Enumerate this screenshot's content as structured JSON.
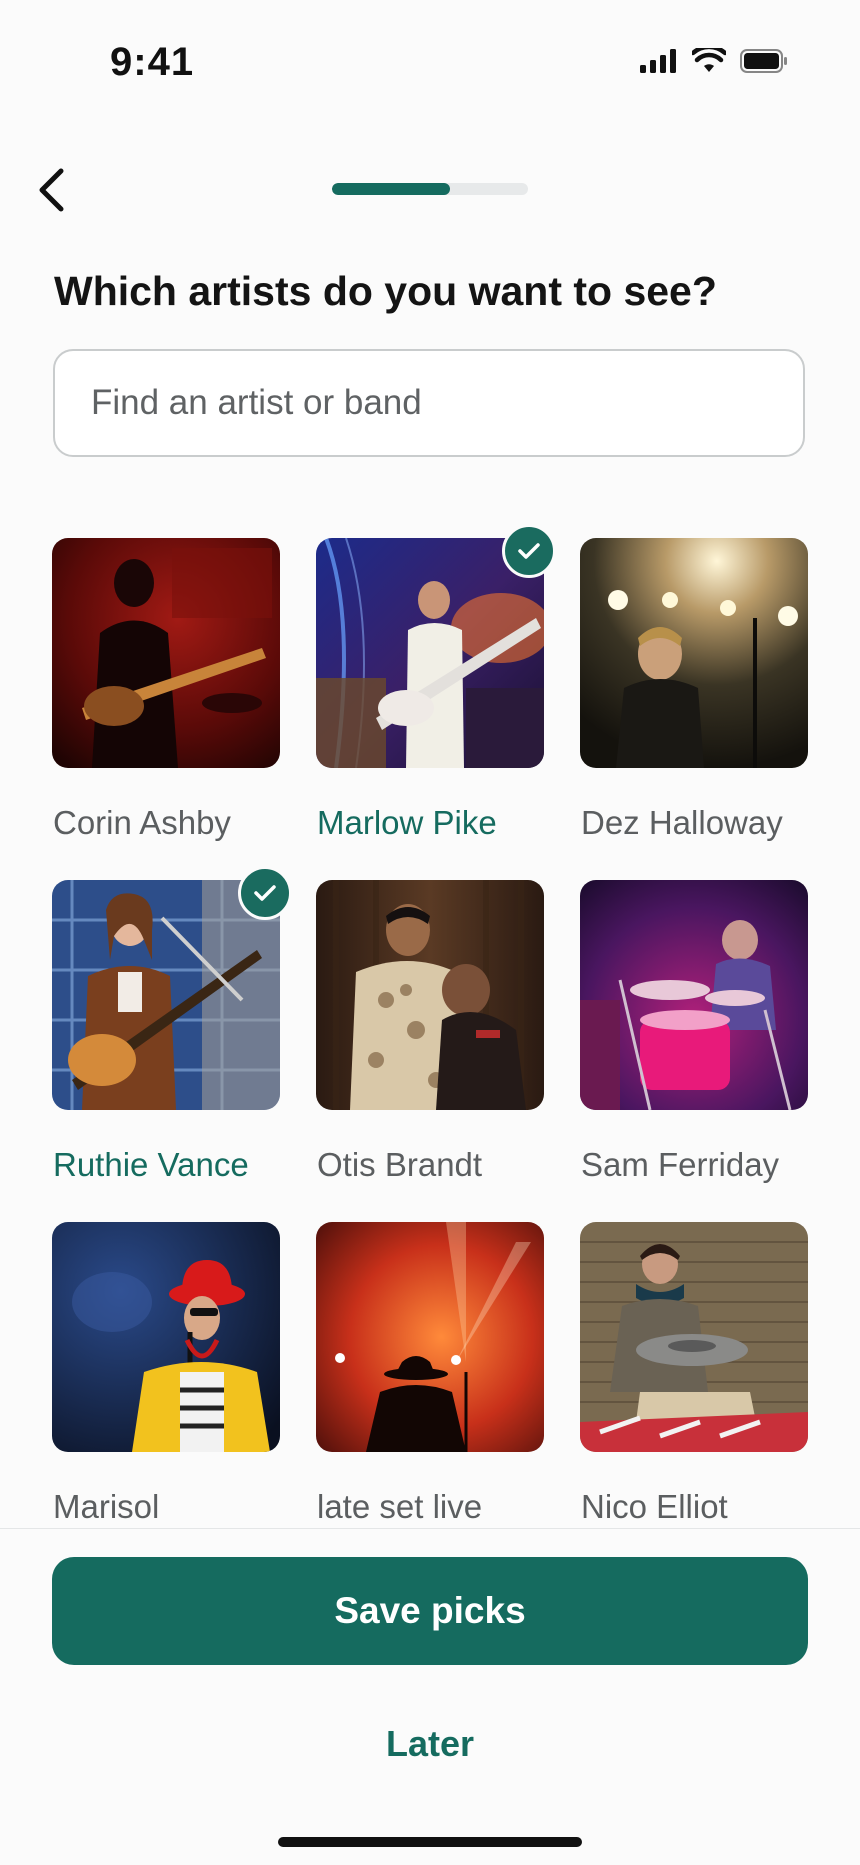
{
  "status_bar": {
    "time": "9:41"
  },
  "header": {
    "progress": 0.6
  },
  "title": "Which artists do you want to see?",
  "search": {
    "placeholder": "Find an artist or band",
    "value": ""
  },
  "artists": [
    {
      "name": "Corin Ashby",
      "selected": false
    },
    {
      "name": "Marlow Pike",
      "selected": true
    },
    {
      "name": "Dez Halloway",
      "selected": false
    },
    {
      "name": "Ruthie Vance",
      "selected": true
    },
    {
      "name": "Otis Brandt",
      "selected": false
    },
    {
      "name": "Sam Ferriday",
      "selected": false
    },
    {
      "name": "Marisol",
      "selected": false
    },
    {
      "name": "late set live",
      "selected": false
    },
    {
      "name": "Nico Elliot",
      "selected": false
    }
  ],
  "actions": {
    "save_label": "Save picks",
    "later_label": "Later"
  },
  "colors": {
    "accent": "#156b5f",
    "badge": "#1a6b5f"
  }
}
